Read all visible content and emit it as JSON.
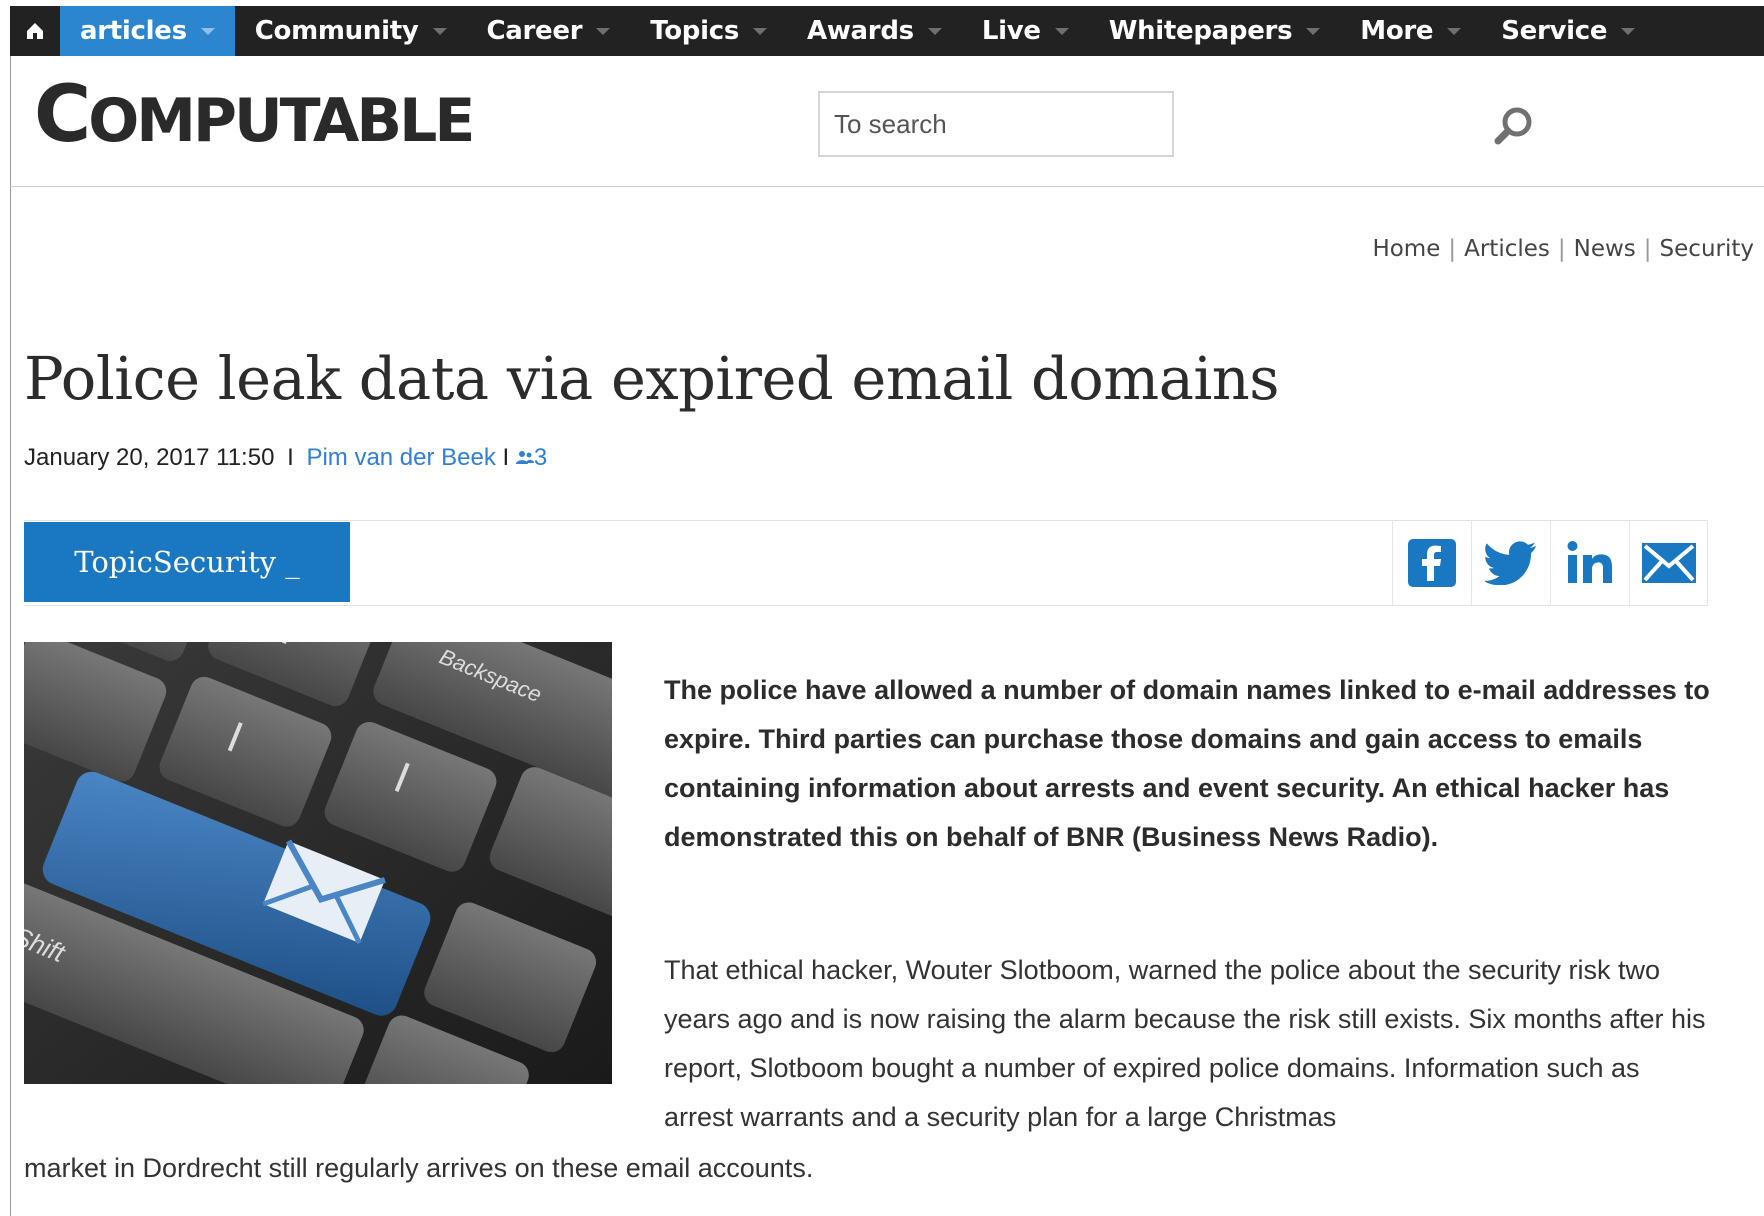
{
  "nav": {
    "home_icon": "home-icon",
    "items": [
      {
        "label": "articles",
        "active": true
      },
      {
        "label": "Community"
      },
      {
        "label": "Career"
      },
      {
        "label": "Topics"
      },
      {
        "label": "Awards"
      },
      {
        "label": "Live"
      },
      {
        "label": "Whitepapers"
      },
      {
        "label": "More"
      },
      {
        "label": "Service"
      }
    ]
  },
  "header": {
    "logo_first": "C",
    "logo_rest": "OMPUTABLE",
    "search_placeholder": "To search",
    "search_icon": "search-icon"
  },
  "breadcrumb": [
    "Home",
    "Articles",
    "News",
    "Security"
  ],
  "article": {
    "title": "Police leak data via expired email domains",
    "date": "January 20, 2017 11:50",
    "separator": "I",
    "author": "Pim van der Beek",
    "comment_separator": "I",
    "comment_count": "3",
    "topic_label": "TopicSecurity _",
    "share": [
      "facebook-icon",
      "twitter-icon",
      "linkedin-icon",
      "email-icon"
    ],
    "image_alt": "Keyboard with blue email key",
    "image_keys": {
      "backspace": "Backspace",
      "shift": "Shift"
    },
    "lead": "The police have allowed a number of domain names linked to e-mail addresses to expire. Third parties can purchase those domains and gain access to emails containing information about arrests and event security. An ethical hacker has demonstrated this on behalf of BNR (Business News Radio).",
    "body_1": "That ethical hacker, Wouter Slotboom, warned the police about the security risk two years ago and is now raising the alarm because the risk still exists. Six months after his report, Slotboom bought a number of expired police domains. Information such as arrest warrants and a security plan for a large Christmas",
    "body_1_cont": "market in Dordrecht still regularly arrives on these email accounts."
  },
  "colors": {
    "nav_bg": "#222222",
    "nav_active": "#2b85cf",
    "topic_btn": "#1a78c2",
    "link": "#2f7fd6",
    "social_blue": "#1a78c2"
  }
}
